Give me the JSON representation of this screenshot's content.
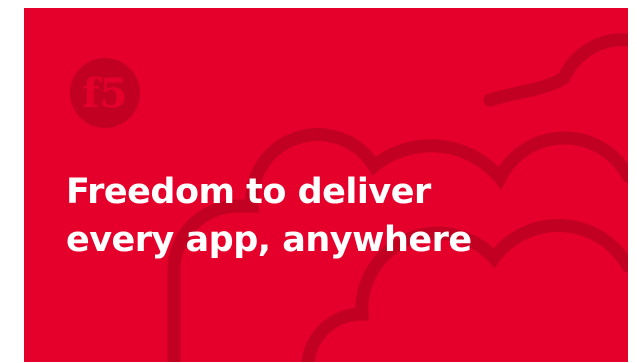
{
  "brand": {
    "logo_text": "f5",
    "background_color": "#e4002b",
    "decor_color": "#c20022",
    "text_color": "#ffffff"
  },
  "headline": {
    "line1": "Freedom to deliver",
    "line2": "every app, anywhere"
  }
}
